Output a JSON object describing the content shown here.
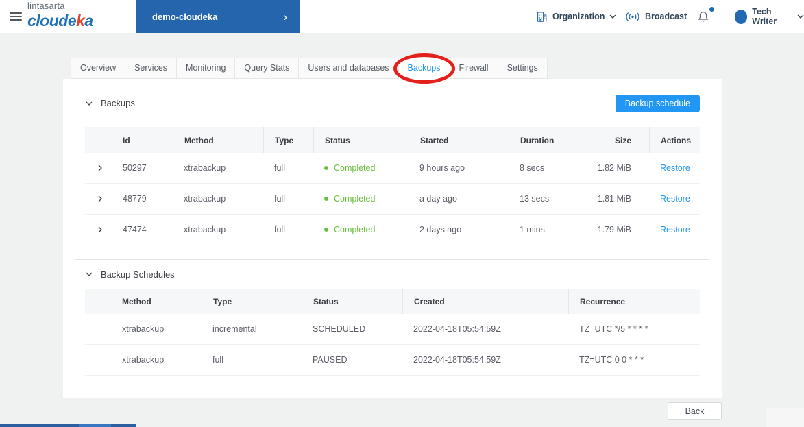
{
  "brand": {
    "company": "lintasarta",
    "product_prefix": "cloude",
    "product_accent": "k",
    "product_suffix": "a"
  },
  "topbar": {
    "project": "demo-cloudeka",
    "organization_label": "Organization",
    "broadcast_label": "Broadcast",
    "user_name": "Tech Writer"
  },
  "tabs": [
    {
      "label": "Overview",
      "active": false
    },
    {
      "label": "Services",
      "active": false
    },
    {
      "label": "Monitoring",
      "active": false
    },
    {
      "label": "Query Stats",
      "active": false
    },
    {
      "label": "Users and databases",
      "active": false
    },
    {
      "label": "Backups",
      "active": true
    },
    {
      "label": "Firewall",
      "active": false
    },
    {
      "label": "Settings",
      "active": false
    }
  ],
  "annotation": {
    "type": "red-circle",
    "target": "Backups"
  },
  "backups": {
    "section_title": "Backups",
    "schedule_button": "Backup schedule",
    "columns": [
      "Id",
      "Method",
      "Type",
      "Status",
      "Started",
      "Duration",
      "Size",
      "Actions"
    ],
    "rows": [
      {
        "id": "50297",
        "method": "xtrabackup",
        "type": "full",
        "status": "Completed",
        "started": "9 hours ago",
        "duration": "8 secs",
        "size": "1.82 MiB",
        "action": "Restore"
      },
      {
        "id": "48779",
        "method": "xtrabackup",
        "type": "full",
        "status": "Completed",
        "started": "a day ago",
        "duration": "13 secs",
        "size": "1.81 MiB",
        "action": "Restore"
      },
      {
        "id": "47474",
        "method": "xtrabackup",
        "type": "full",
        "status": "Completed",
        "started": "2 days ago",
        "duration": "1 mins",
        "size": "1.79 MiB",
        "action": "Restore"
      }
    ]
  },
  "schedules": {
    "section_title": "Backup Schedules",
    "columns": [
      "Method",
      "Type",
      "Status",
      "Created",
      "Recurrence"
    ],
    "rows": [
      {
        "method": "xtrabackup",
        "type": "incremental",
        "status": "SCHEDULED",
        "created": "2022-04-18T05:54:59Z",
        "recurrence": "TZ=UTC */5 * * * *"
      },
      {
        "method": "xtrabackup",
        "type": "full",
        "status": "PAUSED",
        "created": "2022-04-18T05:54:59Z",
        "recurrence": "TZ=UTC 0 0 * * *"
      }
    ]
  },
  "footer": {
    "back_label": "Back"
  },
  "colors": {
    "primary_blue": "#2196f3",
    "header_blue": "#2565ad",
    "success_green": "#67c23a",
    "annotation_red": "#e3201c",
    "logo_blue": "#1f72b8",
    "logo_red": "#e8432d",
    "page_background": "#f0f1f1"
  }
}
